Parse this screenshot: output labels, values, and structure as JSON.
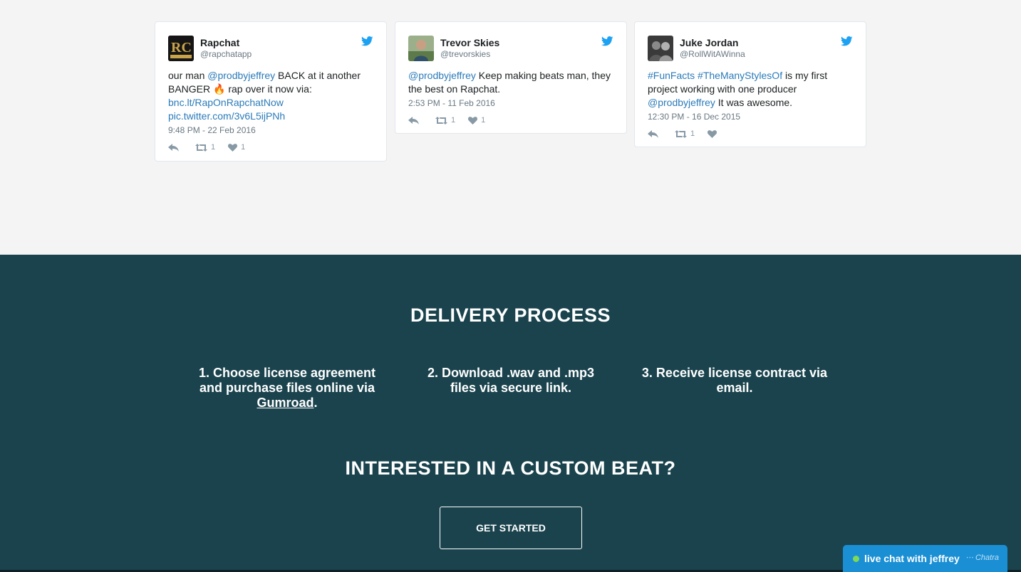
{
  "tweets": [
    {
      "name": "Rapchat",
      "handle": "@rapchatapp",
      "text_parts": [
        "our man ",
        "@prodbyjeffrey",
        " BACK at it another BANGER ",
        "🔥",
        " rap over it now via: "
      ],
      "link1": "bnc.lt/RapOnRapchatNow",
      "link2": "pic.twitter.com/3v6L5ijPNh",
      "timestamp": "9:48 PM - 22 Feb 2016",
      "retweets": "1",
      "likes": "1"
    },
    {
      "name": "Trevor Skies",
      "handle": "@trevorskies",
      "mention": "@prodbyjeffrey",
      "text": " Keep making beats man, they the best on Rapchat.",
      "timestamp": "2:53 PM - 11 Feb 2016",
      "retweets": "1",
      "likes": "1"
    },
    {
      "name": "Juke Jordan",
      "handle": "@RollWitAWinna",
      "hashtag1": "#FunFacts",
      "hashtag2": "#TheManyStylesOf",
      "text1": " is my first project working with one producer ",
      "mention": "@prodbyjeffrey",
      "text2": " It was awesome.",
      "timestamp": "12:30 PM - 16 Dec 2015",
      "retweets": "1",
      "likes": ""
    }
  ],
  "delivery": {
    "title": "DELIVERY PROCESS",
    "step1_text": "1. Choose license agreement and purchase files online via ",
    "step1_link": "Gumroad",
    "step1_end": ".",
    "step2": "2. Download .wav and .mp3 files via secure link.",
    "step3": "3. Receive license contract via email."
  },
  "custom": {
    "title": "INTERESTED IN A CUSTOM BEAT?",
    "button": "GET STARTED"
  },
  "chat": {
    "label": "live chat with jeffrey",
    "brand": "Chatra"
  },
  "colors": {
    "section_bg": "#1a434d",
    "page_bg": "#f4f4f4",
    "link": "#2b7bb9",
    "chat_bg": "#1a8fd4"
  }
}
